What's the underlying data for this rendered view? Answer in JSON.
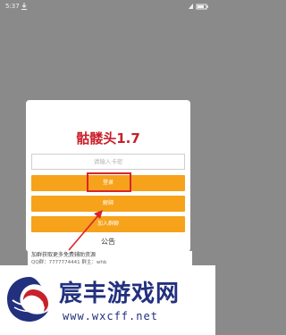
{
  "status_bar": {
    "time": "5:37"
  },
  "dialog": {
    "title": "骷髅头1.7",
    "input_placeholder": "请输入卡密",
    "login_label": "登录",
    "unbind_label": "解绑",
    "group_label": "加入群聊",
    "notice_title": "公告",
    "notice_text": "加群获取更多免费辅助资源",
    "notice_sub": "QQ群：7777774441  群主：whb"
  },
  "watermark": {
    "name": "宸丰游戏网",
    "url": "www.wxcff.net"
  },
  "colors": {
    "accent": "#f6a21b",
    "title_red": "#c8202a",
    "highlight_red": "#d9242a",
    "brand_blue": "#22307e"
  }
}
